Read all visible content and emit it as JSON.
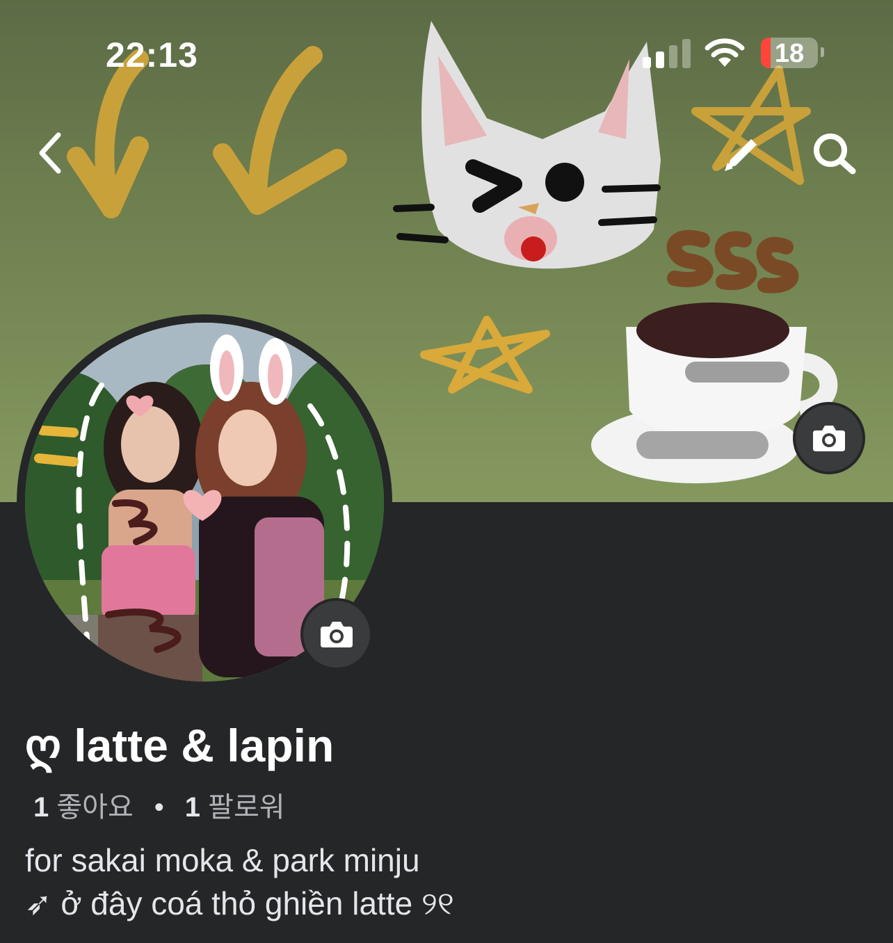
{
  "status_bar": {
    "time": "22:13",
    "battery": "18"
  },
  "header": {
    "back_icon": "chevron-left-icon",
    "edit_icon": "pencil-icon",
    "search_icon": "search-icon"
  },
  "profile": {
    "name_prefix": "ღ",
    "name": "latte & lapin",
    "likes_count": "1",
    "likes_label": "좋아요",
    "separator": "•",
    "followers_count": "1",
    "followers_label": "팔로워",
    "bio_line1": "for sakai moka & park minju",
    "bio_line2_icon": "➶",
    "bio_line2": "ở đây coá thỏ ghiền latte ୨୧"
  },
  "colors": {
    "background": "#252628",
    "cover_top": "#5c6b45",
    "cover_bottom": "#85995f",
    "battery_low": "#ff453a"
  }
}
